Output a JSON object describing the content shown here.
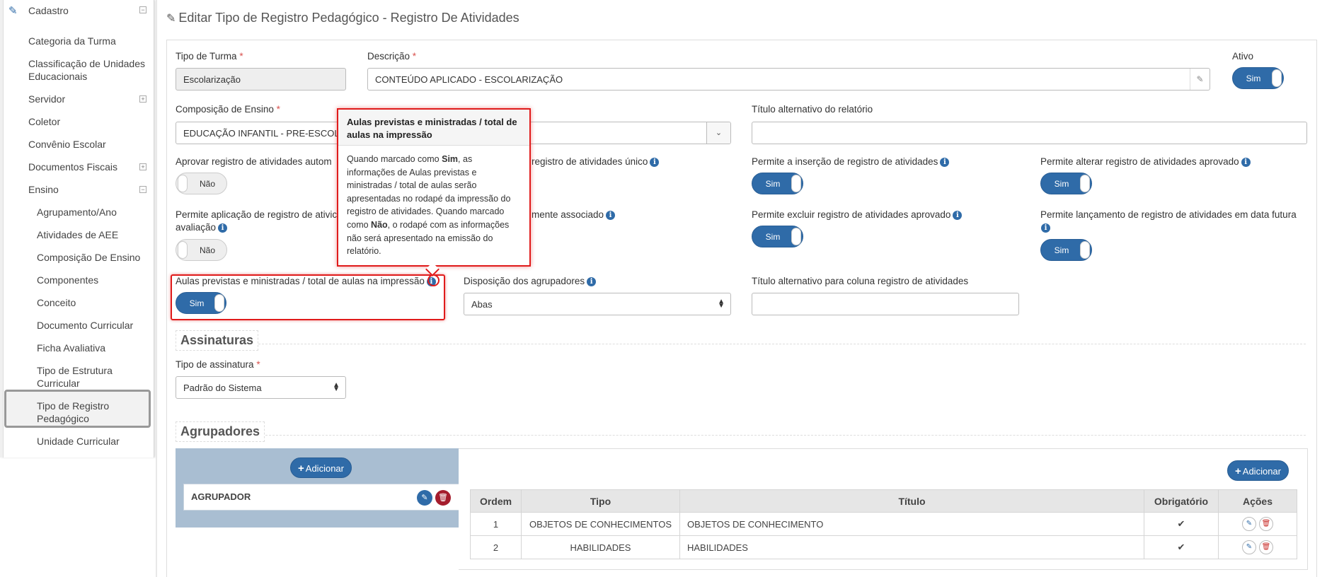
{
  "sidebar": {
    "cadastro": "Cadastro",
    "items": [
      "Categoria da Turma",
      "Classificação de Unidades Educacionais",
      "Servidor",
      "Coletor",
      "Convênio Escolar",
      "Documentos Fiscais",
      "Ensino"
    ],
    "ensino_items": [
      "Agrupamento/Ano",
      "Atividades de AEE",
      "Composição De Ensino",
      "Componentes",
      "Conceito",
      "Documento Curricular",
      "Ficha Avaliativa",
      "Tipo de Estrutura Curricular",
      "Tipo de Registro Pedagógico",
      "Unidade Curricular"
    ],
    "active_item": "Tipo de Registro Pedagógico"
  },
  "page": {
    "title": "Editar Tipo de Registro Pedagógico - Registro De Atividades"
  },
  "form": {
    "tipo_turma": {
      "label": "Tipo de Turma",
      "value": "Escolarização"
    },
    "descricao": {
      "label": "Descrição",
      "value": "CONTEÚDO APLICADO - ESCOLARIZAÇÃO"
    },
    "ativo": {
      "label": "Ativo",
      "value": "Sim"
    },
    "composicao": {
      "label": "Composição de Ensino",
      "value": "EDUCAÇÃO INFANTIL - PRE-ESCOLA"
    },
    "titulo_alt_relatorio": {
      "label": "Título alternativo do relatório",
      "value": ""
    },
    "aprovar_auto": {
      "label": "Aprovar registro de atividades autom",
      "value": "Não"
    },
    "registro_unico": {
      "label": "registro de atividades único"
    },
    "permite_insercao": {
      "label": "Permite a inserção de registro de atividades",
      "value": "Sim"
    },
    "permite_alterar": {
      "label": "Permite alterar registro de atividades aprovado",
      "value": "Sim"
    },
    "permite_aplicacao": {
      "label": "Permite aplicação de registro de ativic",
      "label2": "avaliação",
      "value": "Não"
    },
    "doc_associado": {
      "label": "mente associado"
    },
    "permite_excluir": {
      "label": "Permite excluir registro de atividades aprovado",
      "value": "Sim"
    },
    "permite_futura": {
      "label": "Permite lançamento de registro de atividades em data futura",
      "value": "Sim"
    },
    "aulas_previstas": {
      "label": "Aulas previstas e ministradas / total de aulas na impressão",
      "value": "Sim"
    },
    "disposicao": {
      "label": "Disposição dos agrupadores",
      "value": "Abas"
    },
    "titulo_alt_coluna": {
      "label": "Título alternativo para coluna registro de atividades",
      "value": ""
    }
  },
  "assinaturas": {
    "title": "Assinaturas",
    "tipo_label": "Tipo de assinatura",
    "tipo_value": "Padrão do Sistema"
  },
  "agrupadores": {
    "title": "Agrupadores",
    "add_label": "Adicionar",
    "card_label": "AGRUPADOR",
    "table_add_label": "Adicionar",
    "columns": [
      "Ordem",
      "Tipo",
      "Título",
      "Obrigatório",
      "Ações"
    ],
    "rows": [
      {
        "ordem": "1",
        "tipo": "OBJETOS DE CONHECIMENTOS",
        "titulo": "OBJETOS DE CONHECIMENTO",
        "obrigatorio": "✔"
      },
      {
        "ordem": "2",
        "tipo": "HABILIDADES",
        "titulo": "HABILIDADES",
        "obrigatorio": "✔"
      }
    ]
  },
  "tooltip": {
    "title": "Aulas previstas e ministradas / total de aulas na impressão",
    "body_1": "Quando marcado como ",
    "body_sim": "Sim",
    "body_2": ", as informações de Aulas previstas e ministradas / total de aulas serão apresentadas no rodapé da impressão do registro de atividades. Quando marcado como ",
    "body_nao": "Não",
    "body_3": ", o rodapé com as informações não será apresentado na emissão do relatório."
  },
  "colors": {
    "primary": "#2f6ba8",
    "danger": "#a51d2d",
    "highlight": "#e01b1b"
  }
}
